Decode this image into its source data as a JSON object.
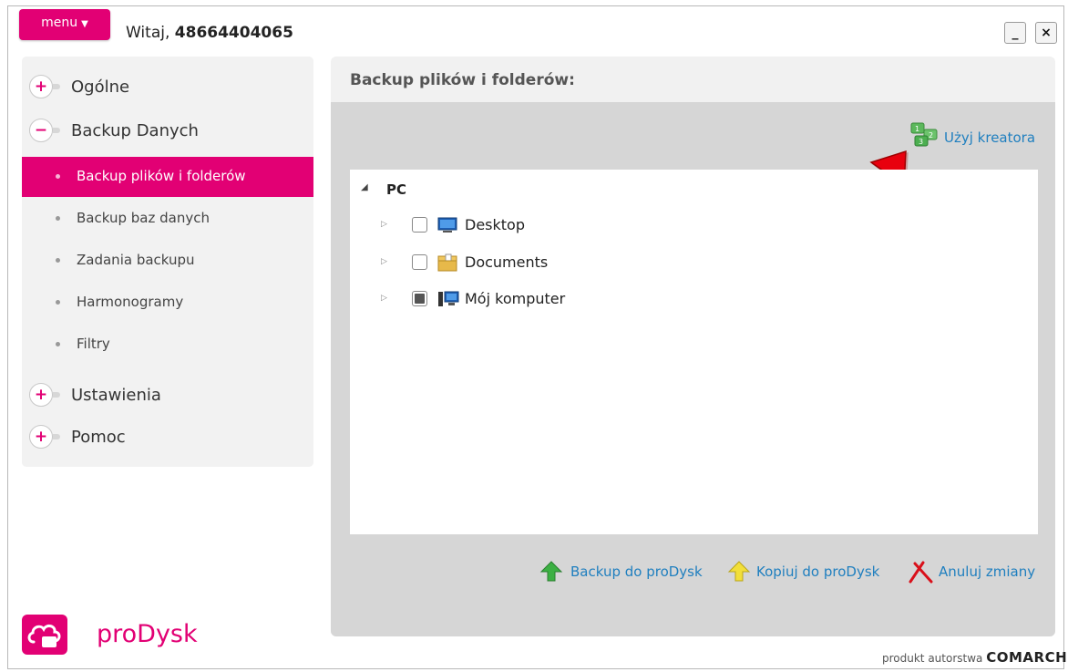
{
  "header": {
    "menu_label": "menu",
    "greeting": "Witaj,",
    "username": "48664404065",
    "minimize_glyph": "_",
    "close_glyph": "×"
  },
  "sidebar": {
    "sections": [
      {
        "label": "Ogólne",
        "state": "+"
      },
      {
        "label": "Backup Danych",
        "state": "−"
      },
      {
        "label": "Ustawienia",
        "state": "+"
      },
      {
        "label": "Pomoc",
        "state": "+"
      }
    ],
    "backup_items": [
      {
        "label": "Backup plików i folderów",
        "active": true
      },
      {
        "label": "Backup baz danych"
      },
      {
        "label": "Zadania backupu"
      },
      {
        "label": "Harmonogramy"
      },
      {
        "label": "Filtry"
      }
    ]
  },
  "brand": {
    "name": "proDysk",
    "color": "#e20074",
    "footer_prefix": "produkt autorstwa",
    "footer_brand": "COMARCH"
  },
  "main": {
    "title": "Backup plików i folderów:",
    "wizard_label": "Użyj kreatora",
    "tree": {
      "root": "PC",
      "children": [
        {
          "label": "Desktop",
          "checked": "empty",
          "icon": "desktop-icon"
        },
        {
          "label": "Documents",
          "checked": "empty",
          "icon": "documents-folder-icon"
        },
        {
          "label": "Mój komputer",
          "checked": "partial",
          "icon": "computer-icon"
        }
      ]
    },
    "actions": {
      "backup": "Backup do proDysk",
      "copy": "Kopiuj do proDysk",
      "cancel": "Anuluj zmiany"
    }
  },
  "annotation": {
    "type": "red-arrow",
    "target": "wizard",
    "color": "#e8000e"
  }
}
